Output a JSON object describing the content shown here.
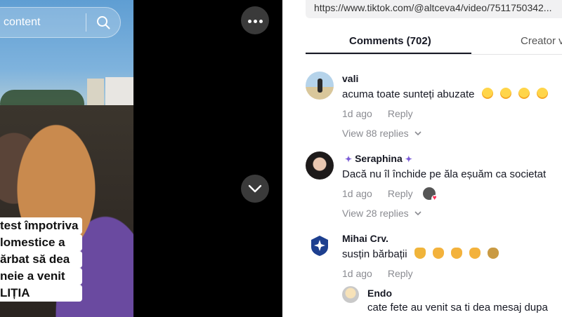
{
  "video": {
    "search_label": "content",
    "caption_lines": [
      "test împotriva",
      "lomestice a",
      "ărbat să dea",
      "neie a venit",
      "LIȚIA"
    ],
    "caption_color": "#ffffff"
  },
  "browser": {
    "url": "https://www.tiktok.com/@altceva4/video/7511750342..."
  },
  "tabs": {
    "comments": "Comments (702)",
    "creator": "Creator v"
  },
  "comments": [
    {
      "user": "vali",
      "text": "acuma toate sunteți abuzate",
      "emojis": [
        "laughing-sweat",
        "laughing-sweat",
        "laughing-sweat",
        "laughing-sweat"
      ],
      "time": "1d ago",
      "reply": "Reply",
      "view_replies": "View 88 replies"
    },
    {
      "user": "Seraphina",
      "text": "Dacă nu îl închide pe ăla eșuăm ca societat",
      "time": "1d ago",
      "reply": "Reply",
      "view_replies": "View 28 replies"
    },
    {
      "user": "Mihai Crv.",
      "text": "susțin bărbații",
      "emojis": [
        "thumbs-up",
        "flexed-biceps",
        "flexed-biceps",
        "flexed-biceps",
        "money-bag"
      ],
      "time": "1d ago",
      "reply": "Reply"
    }
  ],
  "sub_reply": {
    "user": "Endo",
    "text": "cate fete au venit sa ti dea mesaj dupa"
  },
  "colors": {
    "accent_text": "#161823",
    "muted_text": "#8a8b91",
    "like_heart": "#fe2c55"
  }
}
